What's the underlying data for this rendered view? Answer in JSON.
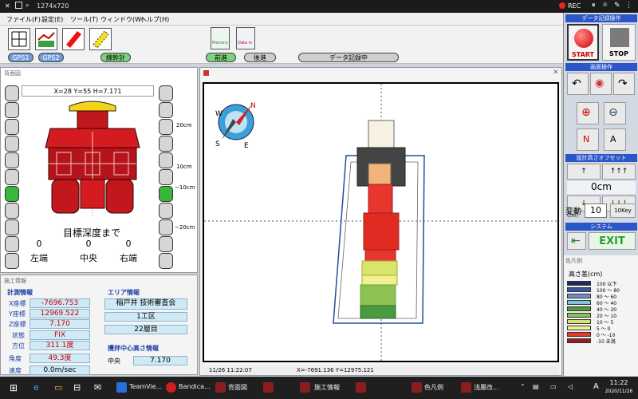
{
  "recorder": {
    "size": "1274x720",
    "rec": "REC"
  },
  "menu": [
    "ファイル(F)",
    "設定(E)",
    "ツール(T)",
    "ウィンドウ(W)",
    "ヘルプ(H)"
  ],
  "toolbar": {
    "gps1": "GPS1",
    "gps2": "GPS2",
    "calib": "線幹計",
    "forward": "前進",
    "backward": "後進",
    "recording": "データ記録中",
    "btn_memory": "Memory",
    "btn_datain": "Data in"
  },
  "left_view": {
    "title": "背面図",
    "coords": "X=28 Y=55 H=7.171",
    "scale": [
      "20cm",
      "10cm",
      "−10cm",
      "−20cm"
    ],
    "target_label": "目標深度まで",
    "bottom_values": [
      "0",
      "0",
      "0"
    ],
    "bottom_labels": [
      "左端",
      "中央",
      "右端"
    ],
    "left_column_active_index": 6,
    "right_column_active_index": 6
  },
  "info": {
    "title": "施工情報",
    "survey_title": "計測情報",
    "x_label": "X座標",
    "x_value": "-7696.753",
    "y_label": "Y座標",
    "y_value": "12969.522",
    "z_label": "Z座標",
    "z_value": "7.170",
    "state_label": "状態",
    "state_value": "FIX",
    "azimuth_label": "方位",
    "azimuth_value": "311.1度",
    "angle_label": "角度",
    "angle_value": "49.3度",
    "speed_label": "速度",
    "speed_value": "0.0m/sec",
    "area_title": "エリア情報",
    "area_name": "稲戸井  技術審査会",
    "area_zone": "1工区",
    "area_layer": "22層目",
    "center_title": "攪拌中心高さ情報",
    "center_label": "中央",
    "center_value": "7.170"
  },
  "drawing": {
    "status_date": "11/26 11:22:07",
    "status_coords": "X=-7691.136 Y=12975.121",
    "compass": {
      "n": "N",
      "s": "S",
      "w": "W",
      "e": "E"
    }
  },
  "right_panel": {
    "record_title": "データ記録操作",
    "start": "START",
    "stop": "STOP",
    "screen_title": "画面操作",
    "offset_title": "設計高さオフセット",
    "up1": "↑",
    "up3": "↑↑↑",
    "offset_value": "0cm",
    "down1": "↓",
    "down3": "↓↓↓",
    "change_label": "変動",
    "change_unit": "(cm)",
    "change_value": "10",
    "tenkey": "10Key",
    "system_title": "システム",
    "exit": "EXIT"
  },
  "legend": {
    "title": "色凡例",
    "heading": "高さ差(cm)",
    "items": [
      {
        "label": "100 以下",
        "color": "#1b2a6b"
      },
      {
        "label": "100 〜 80",
        "color": "#3e4f9e"
      },
      {
        "label": "80 〜 60",
        "color": "#6f8ec9"
      },
      {
        "label": "60 〜 40",
        "color": "#7ec4e0"
      },
      {
        "label": "40 〜 20",
        "color": "#4a9a3f"
      },
      {
        "label": "20 〜 10",
        "color": "#8cc153"
      },
      {
        "label": "10 〜 5",
        "color": "#d8e46a"
      },
      {
        "label": "5 〜 0",
        "color": "#f0ef92"
      },
      {
        "label": "0 〜 -10",
        "color": "#e8352d"
      },
      {
        "label": "-10 未満",
        "color": "#9e1b1b"
      }
    ]
  },
  "taskbar": {
    "items": [
      "TeamVie...",
      "Bandica...",
      "背面図",
      "施工情報",
      "色凡例",
      "浅層改..."
    ],
    "time": "11:22",
    "date": "2020/11/26",
    "ime": "A"
  }
}
